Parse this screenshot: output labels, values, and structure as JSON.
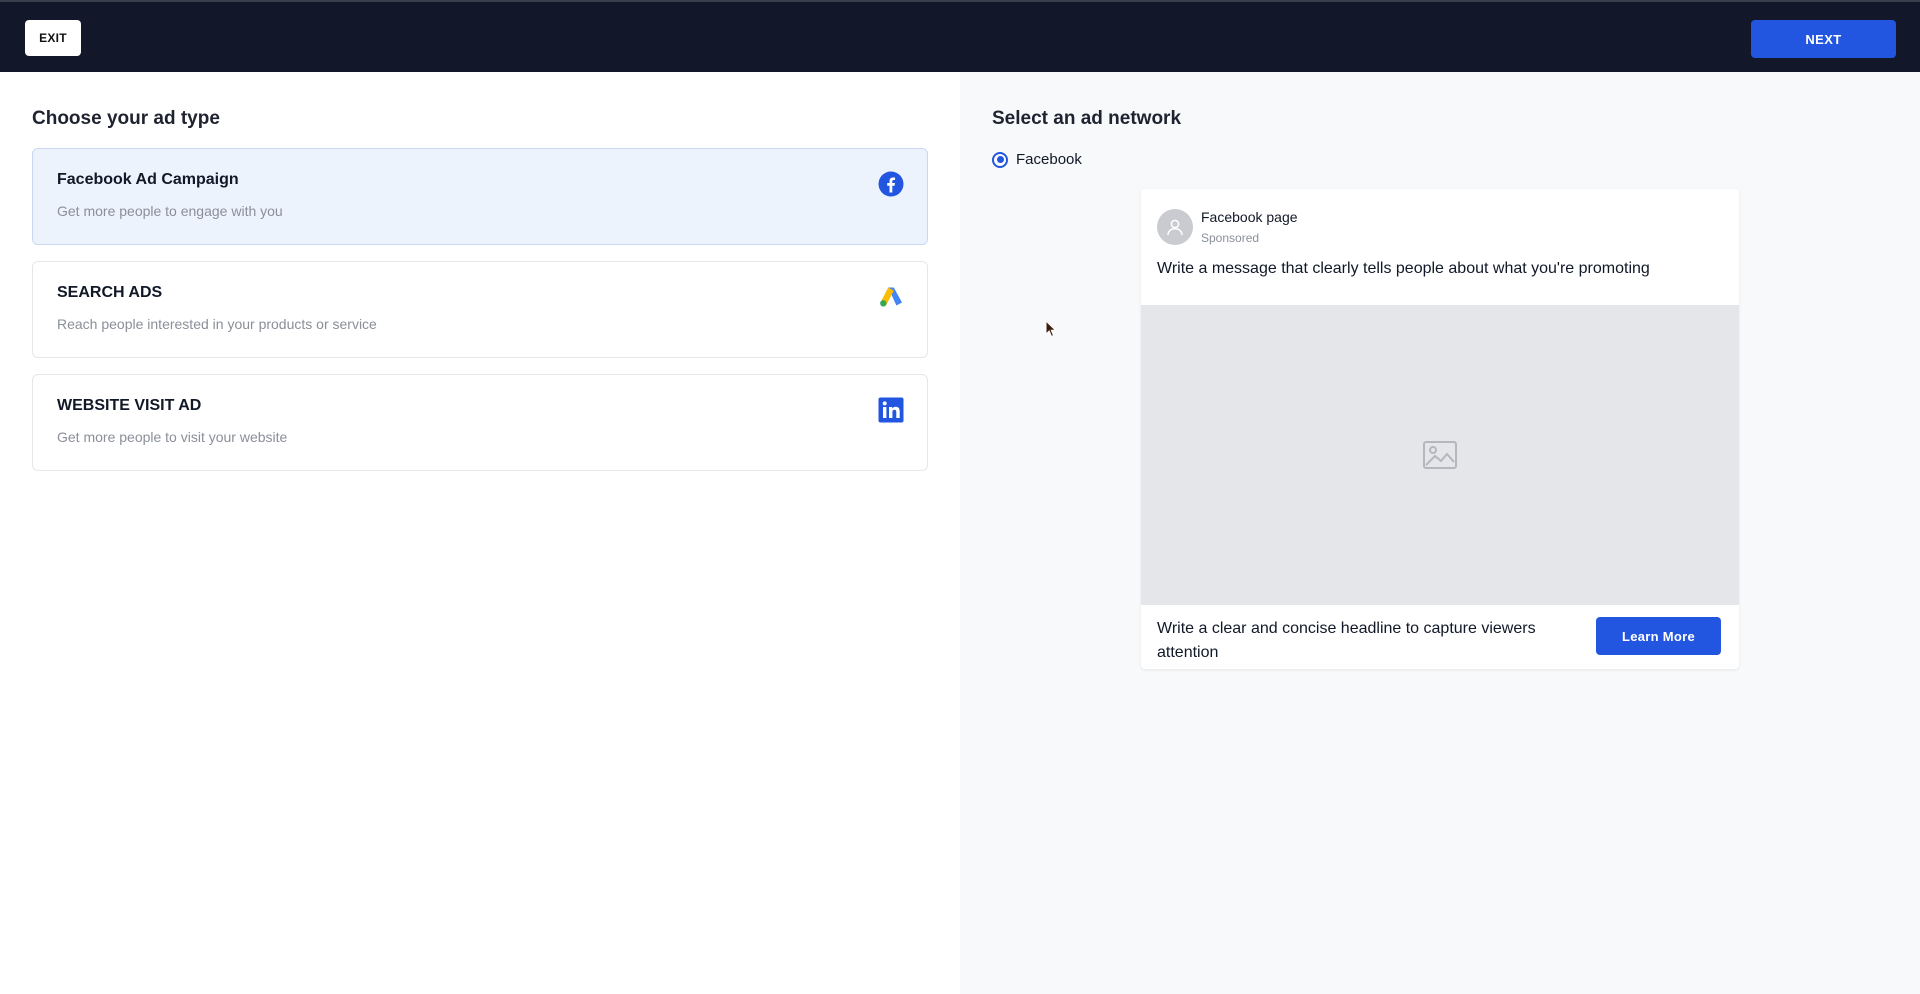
{
  "header": {
    "exit_label": "EXIT",
    "next_label": "NEXT"
  },
  "ad_type": {
    "title": "Choose your ad type",
    "options": [
      {
        "title": "Facebook Ad Campaign",
        "subtitle": "Get more people to engage with you",
        "icon": "facebook-icon",
        "selected": true
      },
      {
        "title": "SEARCH ADS",
        "subtitle": "Reach people interested in your products or service",
        "icon": "google-ads-icon",
        "selected": false
      },
      {
        "title": "WEBSITE VISIT AD",
        "subtitle": "Get more people to visit your website",
        "icon": "linkedin-icon",
        "selected": false
      }
    ]
  },
  "network": {
    "title": "Select an ad network",
    "selected_option": "Facebook"
  },
  "preview": {
    "page_name": "Facebook page",
    "sponsored": "Sponsored",
    "message": "Write a message that clearly tells people about what you're promoting",
    "image_icon": "image-placeholder-icon",
    "headline": "Write a clear and concise headline to capture viewers attention",
    "cta_label": "Learn More"
  },
  "colors": {
    "topbar": "#12172a",
    "primary": "#2256e0",
    "selected_card": "#edf3fd",
    "right_panel": "#f8f9fb"
  }
}
